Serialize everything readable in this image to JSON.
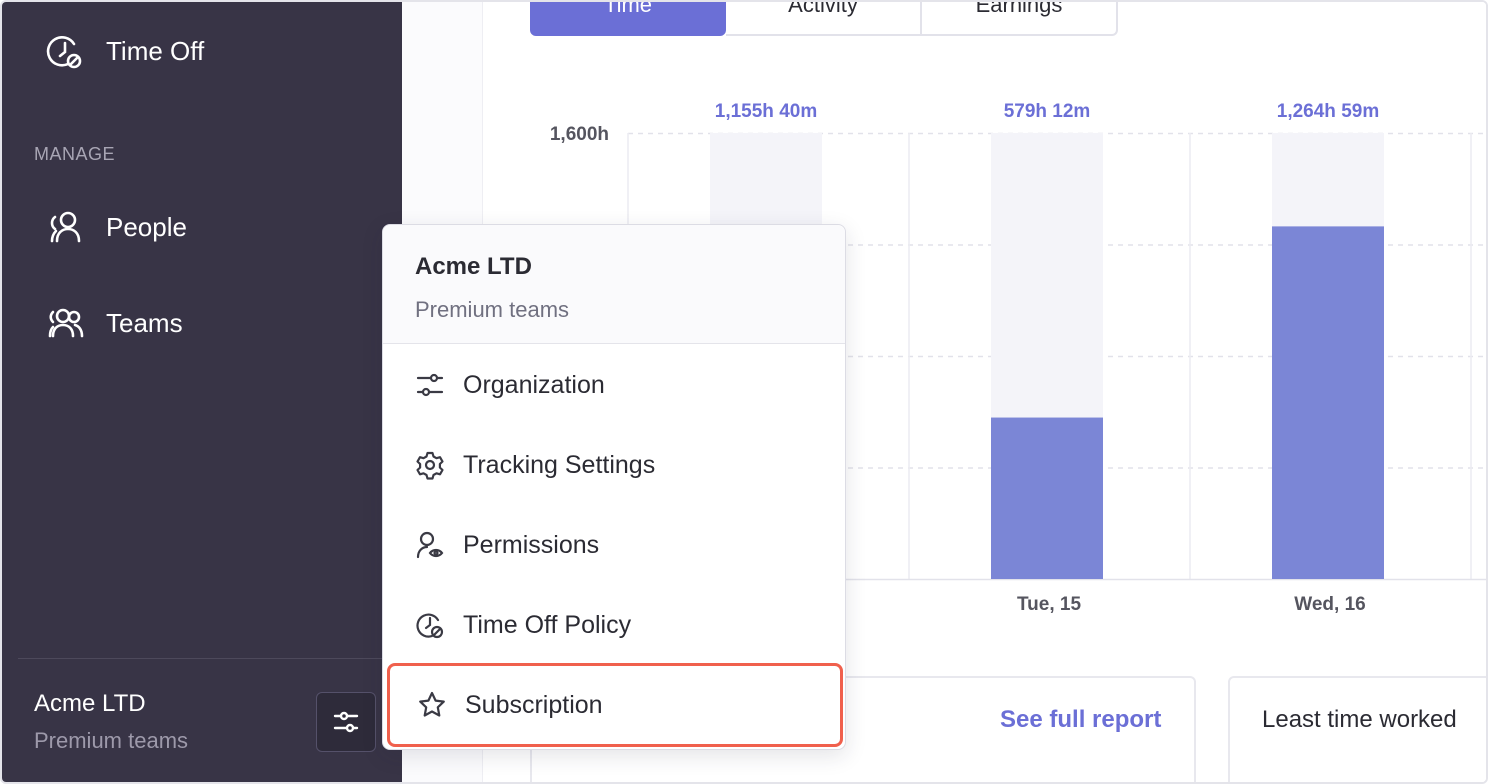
{
  "sidebar": {
    "time_off_label": "Time Off",
    "section_manage": "MANAGE",
    "people_label": "People",
    "teams_label": "Teams",
    "org_name": "Acme LTD",
    "org_plan": "Premium teams"
  },
  "tabs": [
    {
      "label": "Time",
      "active": true
    },
    {
      "label": "Activity",
      "active": false
    },
    {
      "label": "Earnings",
      "active": false
    }
  ],
  "chart_data": {
    "type": "bar",
    "ytick_top": "1,600h",
    "ylim": [
      0,
      1600
    ],
    "categories": [
      "Tue, 15",
      "Wed, 16"
    ],
    "columns": [
      {
        "category": "",
        "label": "1,155h 40m",
        "value": 1155.67
      },
      {
        "category": "Tue, 15",
        "label": "579h 12m",
        "value": 579.2
      },
      {
        "category": "Wed, 16",
        "label": "1,264h 59m",
        "value": 1264.98
      }
    ],
    "bar_color": "#7b86d6",
    "track_color": "#f4f4f9"
  },
  "cards": {
    "see_full_report": "See full report",
    "least_time_worked": "Least time worked"
  },
  "dropdown": {
    "org_name": "Acme LTD",
    "org_plan": "Premium teams",
    "items": [
      {
        "label": "Organization",
        "icon": "sliders-icon"
      },
      {
        "label": "Tracking Settings",
        "icon": "gear-icon"
      },
      {
        "label": "Permissions",
        "icon": "user-eye-icon"
      },
      {
        "label": "Time Off Policy",
        "icon": "clock-off-icon"
      },
      {
        "label": "Subscription",
        "icon": "star-icon",
        "highlighted": true
      }
    ]
  },
  "colors": {
    "sidebar_bg": "#383446",
    "accent": "#6b6fd6",
    "highlight_border": "#f0604d"
  }
}
